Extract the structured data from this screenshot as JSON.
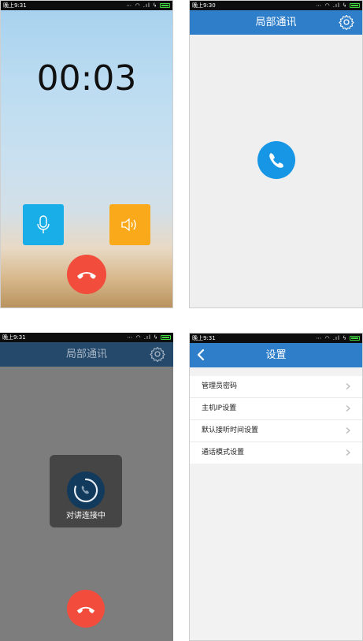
{
  "screens": {
    "call_active": {
      "status_time": "晚上9:31",
      "timer": "00:03"
    },
    "home": {
      "status_time": "晚上9:30",
      "title": "局部通讯"
    },
    "connecting": {
      "status_time": "晚上9:31",
      "title": "局部通讯",
      "toast_text": "对讲连接中"
    },
    "settings": {
      "status_time": "晚上9:31",
      "title": "设置",
      "items": [
        {
          "label": "管理员密码"
        },
        {
          "label": "主机IP设置"
        },
        {
          "label": "默认接听时间设置"
        },
        {
          "label": "通话模式设置"
        }
      ]
    }
  },
  "colors": {
    "title_bar": "#2f7ec9",
    "mic_button": "#1aaee8",
    "speaker_button": "#f9a91a",
    "hangup_button": "#f24c3c",
    "call_button": "#1796e5"
  },
  "icons": [
    "microphone-icon",
    "speaker-icon",
    "hangup-phone-icon",
    "phone-icon",
    "gear-icon",
    "back-chevron-icon",
    "chevron-right-icon",
    "loading-spinner-icon"
  ]
}
